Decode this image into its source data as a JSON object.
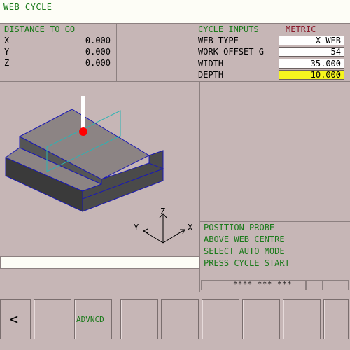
{
  "title": "WEB CYCLE",
  "distance_to_go": {
    "title": "DISTANCE TO GO",
    "rows": [
      {
        "axis": "X",
        "value": "0.000"
      },
      {
        "axis": "Y",
        "value": "0.000"
      },
      {
        "axis": "Z",
        "value": "0.000"
      }
    ]
  },
  "cycle_inputs": {
    "title": "CYCLE INPUTS",
    "unit": "METRIC",
    "fields": [
      {
        "label": "WEB TYPE",
        "value": "X WEB"
      },
      {
        "label": "WORK OFFSET G",
        "value": "54"
      },
      {
        "label": "WIDTH",
        "value": "35.000"
      },
      {
        "label": "DEPTH",
        "value": "10.000"
      }
    ]
  },
  "axes": {
    "z": "Z",
    "y": "Y",
    "x": "X"
  },
  "messages": [
    "POSITION PROBE",
    "ABOVE WEB CENTRE",
    "SELECT AUTO MODE",
    "PRESS CYCLE START"
  ],
  "status": "**** *** ***",
  "softkeys": {
    "back": "<",
    "advanced": "ADVNCD"
  },
  "colors": {
    "accent_green": "#1a7a1a",
    "metric_red": "#8a1a2a",
    "highlight_yellow": "#f5f51e",
    "probe_red": "#ff0000"
  }
}
